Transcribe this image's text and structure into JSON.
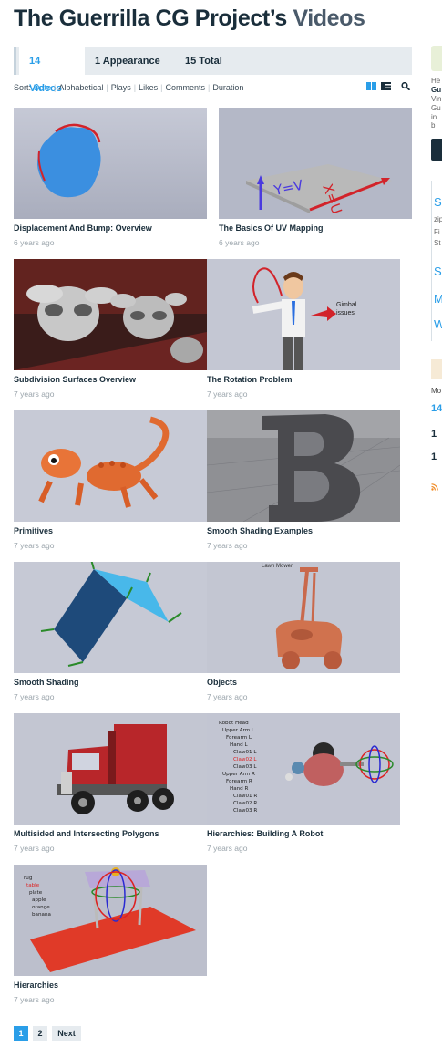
{
  "header": {
    "owner": "The Guerrilla CG Project’s",
    "suffix": "Videos"
  },
  "tabs": [
    {
      "label": "14 Videos",
      "active": true
    },
    {
      "label": "1 Appearance",
      "active": false
    },
    {
      "label": "15 Total",
      "active": false
    }
  ],
  "sort": {
    "label": "Sort:",
    "options": [
      "Date",
      "Alphabetical",
      "Plays",
      "Likes",
      "Comments",
      "Duration"
    ],
    "selected": "Date"
  },
  "view_icons": [
    "grid-view-icon",
    "list-view-icon",
    "search-icon"
  ],
  "videos": [
    {
      "title": "Displacement And Bump: Overview",
      "age": "6 years ago"
    },
    {
      "title": "The Basics Of UV Mapping",
      "age": "6 years ago",
      "thumb_text": [
        "Y=V",
        "X=U"
      ]
    },
    {
      "title": "Subdivision Surfaces Overview",
      "age": "7 years ago"
    },
    {
      "title": "The Rotation Problem",
      "age": "7 years ago",
      "thumb_text": [
        "Gimbal",
        "issues"
      ]
    },
    {
      "title": "Primitives",
      "age": "7 years ago"
    },
    {
      "title": "Smooth Shading Examples",
      "age": "7 years ago"
    },
    {
      "title": "Smooth Shading",
      "age": "7 years ago"
    },
    {
      "title": "Objects",
      "age": "7 years ago",
      "thumb_text": [
        "Lawn Mower"
      ]
    },
    {
      "title": "Multisided and Intersecting Polygons",
      "age": "7 years ago"
    },
    {
      "title": "Hierarchies: Building A Robot",
      "age": "7 years ago",
      "thumb_text": [
        "Robot Head",
        "Upper Arm L",
        "Forearm L",
        "Hand L",
        "Claw01 L",
        "Claw02 L",
        "Claw03 L",
        "Upper Arm R",
        "Forearm R",
        "Hand R",
        "Claw01 R",
        "Claw02 R",
        "Claw03 R"
      ]
    },
    {
      "title": "Hierarchies",
      "age": "7 years ago",
      "thumb_text": [
        "rug",
        "table",
        "plate",
        "apple",
        "orange",
        "banana"
      ]
    }
  ],
  "pagination": {
    "pages": [
      "1",
      "2"
    ],
    "current": "1",
    "next_label": "Next"
  },
  "sidebar_fragments": {
    "t1": "He",
    "t2": "Gu",
    "t3": "Vin",
    "t4": "Gu",
    "t5": "in b",
    "s1": "S",
    "s2": "zip",
    "s3": "Fi",
    "s4": "St",
    "s5": "S",
    "s6": "M",
    "s7": "W",
    "m1": "Mo",
    "m2": "14",
    "m3": "1",
    "m4": "1"
  },
  "colors": {
    "accent": "#2a9ee8",
    "heading": "#1a2e3b",
    "meta": "#9aa4ab",
    "tabbar": "#e6ebef"
  }
}
